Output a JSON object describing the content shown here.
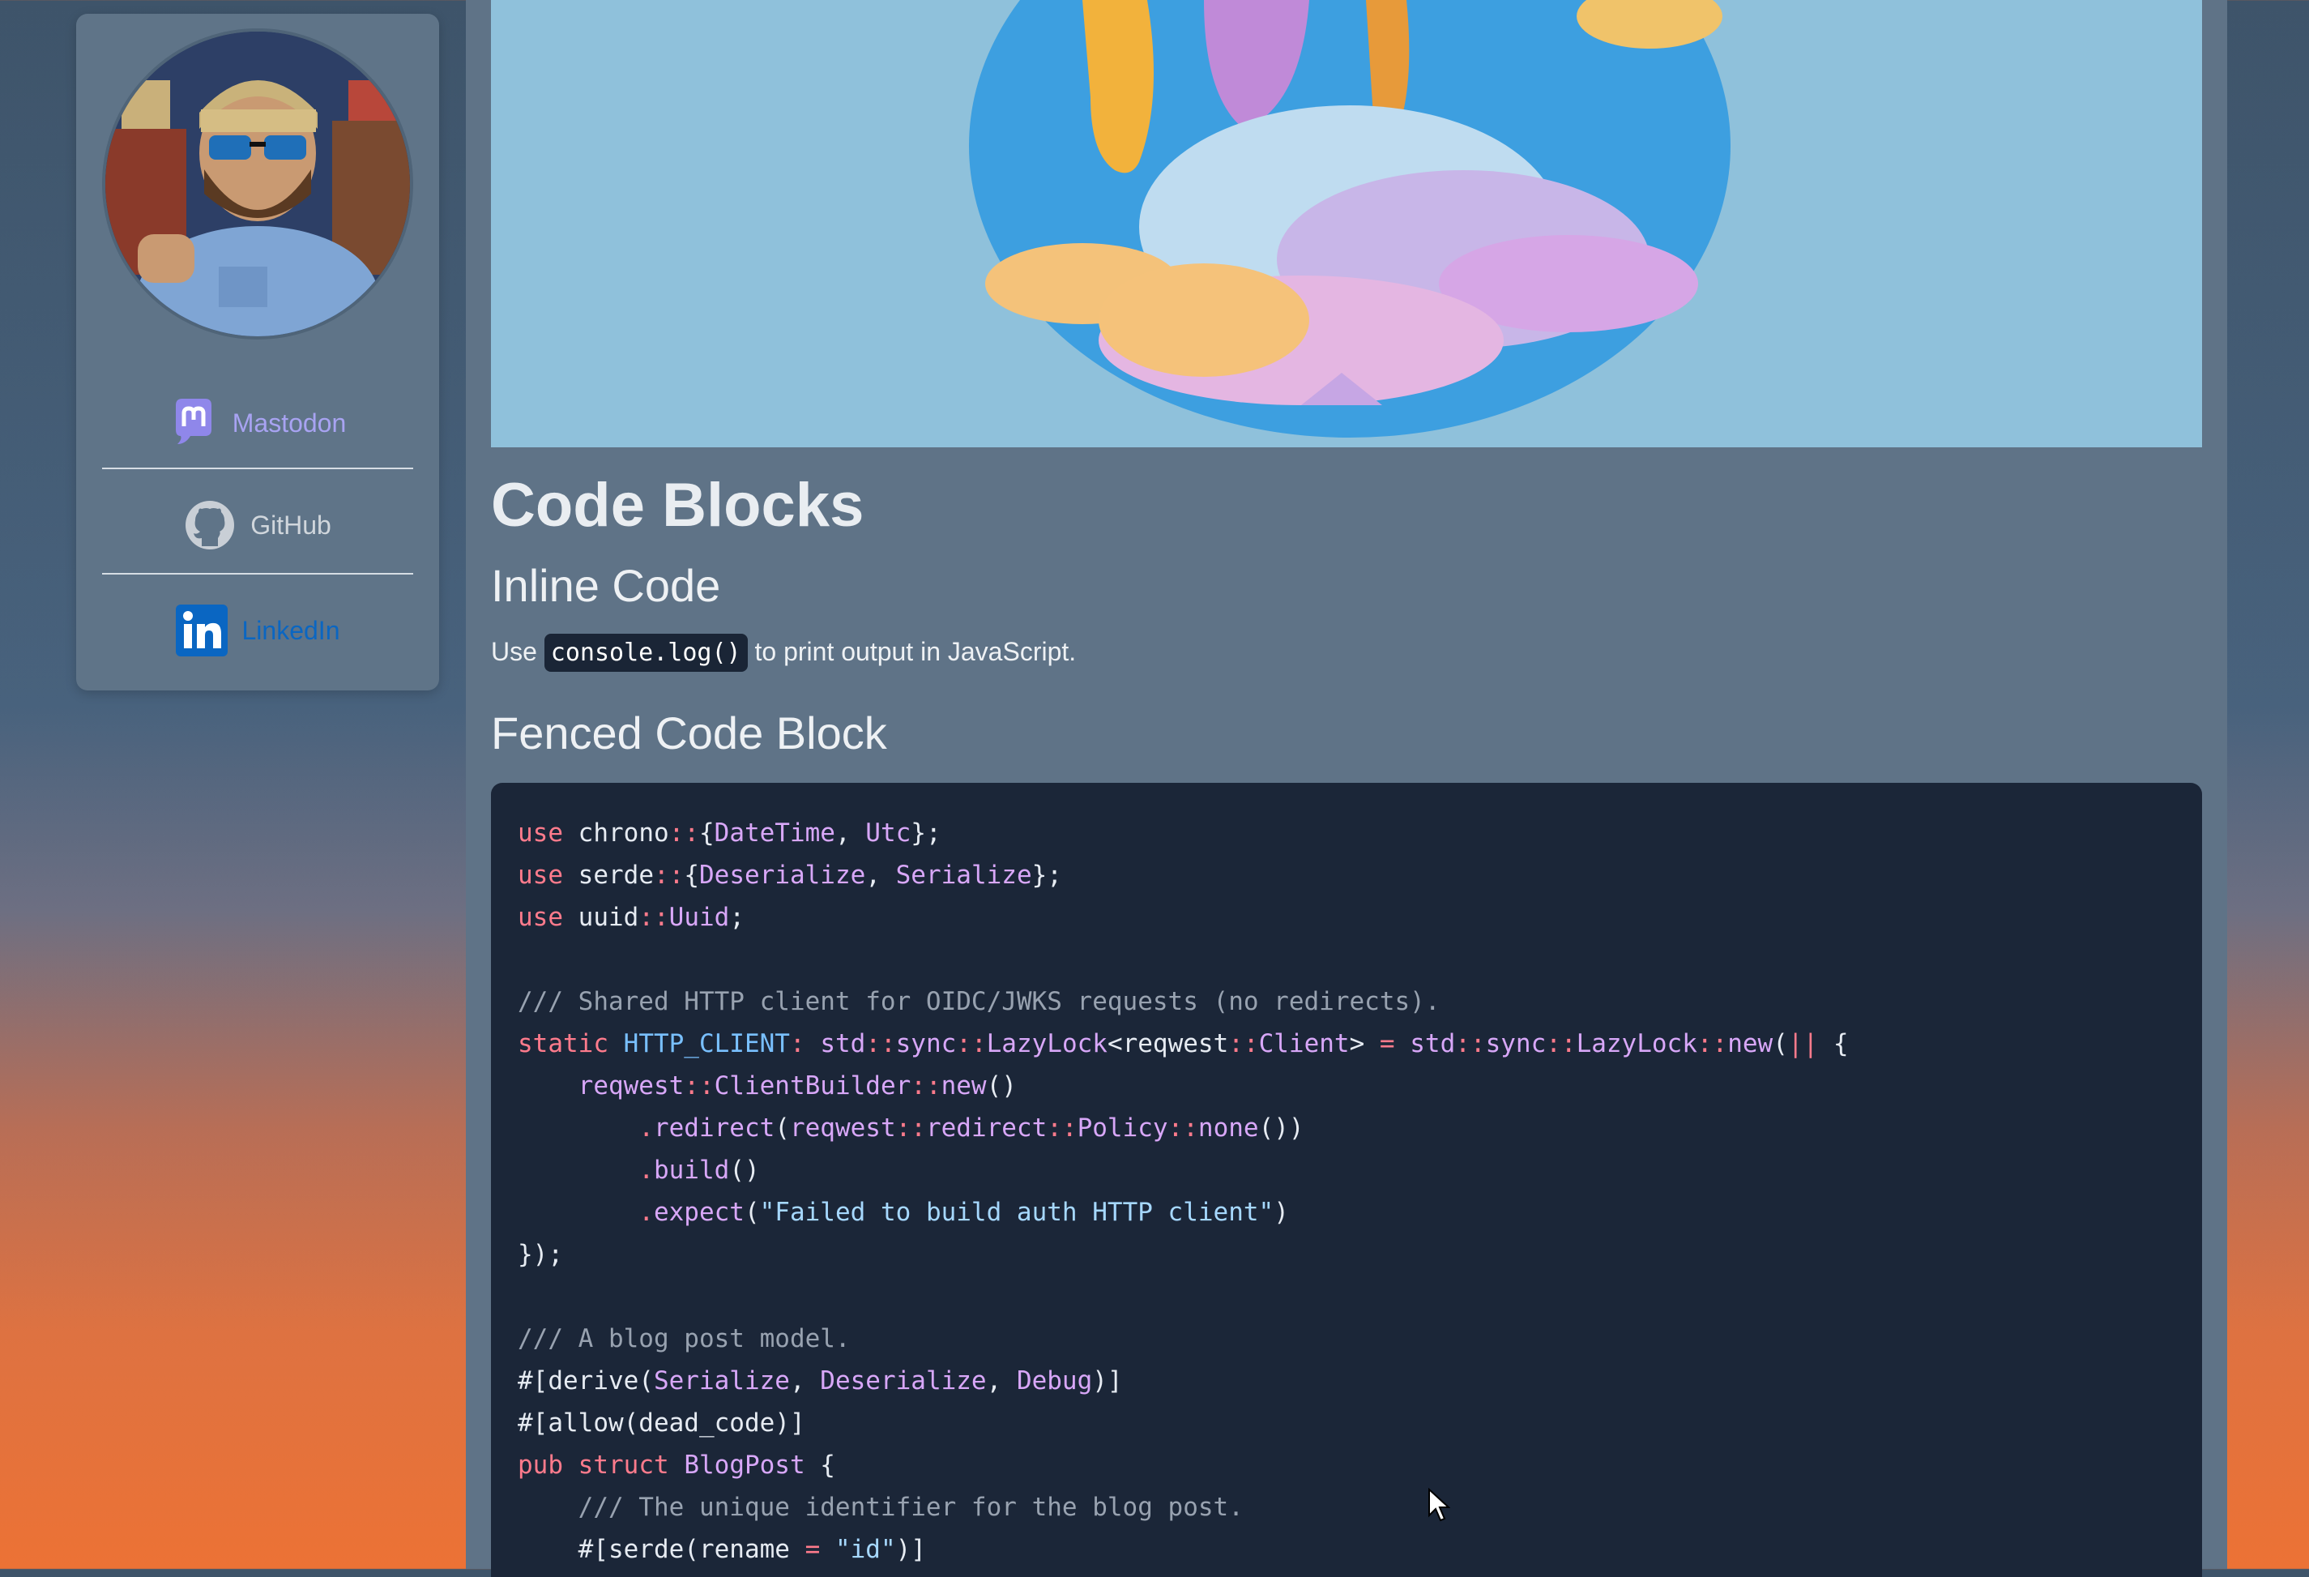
{
  "sidebar": {
    "links": [
      {
        "label": "Mastodon",
        "icon": "mastodon-icon",
        "color": "#a8a3f2"
      },
      {
        "label": "GitHub",
        "icon": "github-icon",
        "color": "#d0d6dc"
      },
      {
        "label": "LinkedIn",
        "icon": "linkedin-icon",
        "color": "#0a66c2"
      }
    ]
  },
  "content": {
    "title": "Code Blocks",
    "inline_heading": "Inline Code",
    "para_before": "Use",
    "inline_code": "console.log()",
    "para_after": "to print output in JavaScript.",
    "fenced_heading": "Fenced Code Block",
    "code": {
      "l1": {
        "a": "use",
        "b": "chrono",
        "c": "::",
        "d": "{",
        "e": "DateTime",
        "f": ", ",
        "g": "Utc",
        "h": "};"
      },
      "l2": {
        "a": "use",
        "b": "serde",
        "c": "::",
        "d": "{",
        "e": "Deserialize",
        "f": ", ",
        "g": "Serialize",
        "h": "};"
      },
      "l3": {
        "a": "use",
        "b": "uuid",
        "c": "::",
        "d": "Uuid",
        "e": ";"
      },
      "l4": {
        "a": "/// Shared HTTP client for OIDC/JWKS requests (no redirects)."
      },
      "l5": {
        "a": "static",
        "b": "HTTP_CLIENT",
        "c": ":",
        "d": "std",
        "e": "::",
        "f": "sync",
        "g": "::",
        "h": "LazyLock",
        "i": "<reqwest",
        "j": "::",
        "k": "Client",
        "l": ">",
        "m": "=",
        "n": "std",
        "o": "::",
        "p": "sync",
        "q": "::",
        "r": "LazyLock",
        "s": "::",
        "t": "new",
        "u": "(",
        "v": "||",
        "w": " {"
      },
      "l6": {
        "a": "reqwest",
        "b": "::",
        "c": "ClientBuilder",
        "d": "::",
        "e": "new",
        "f": "()"
      },
      "l7": {
        "a": ".",
        "b": "redirect",
        "c": "(",
        "d": "reqwest",
        "e": "::",
        "f": "redirect",
        "g": "::",
        "h": "Policy",
        "i": "::",
        "j": "none",
        "k": "())"
      },
      "l8": {
        "a": ".",
        "b": "build",
        "c": "()"
      },
      "l9": {
        "a": ".",
        "b": "expect",
        "c": "(",
        "d": "\"Failed to build auth HTTP client\"",
        "e": ")"
      },
      "l10": {
        "a": "});"
      },
      "l11": {
        "a": "/// A blog post model."
      },
      "l12": {
        "a": "#[derive(",
        "b": "Serialize",
        "c": ", ",
        "d": "Deserialize",
        "e": ", ",
        "f": "Debug",
        "g": ")]"
      },
      "l13": {
        "a": "#[allow(dead_code)]"
      },
      "l14": {
        "a": "pub",
        "b": "struct",
        "c": "BlogPost",
        "d": " {"
      },
      "l15": {
        "a": "/// The unique identifier for the blog post."
      },
      "l16": {
        "a": "#[serde(rename",
        "b": "=",
        "c": "\"id\"",
        "d": ")]"
      }
    }
  }
}
